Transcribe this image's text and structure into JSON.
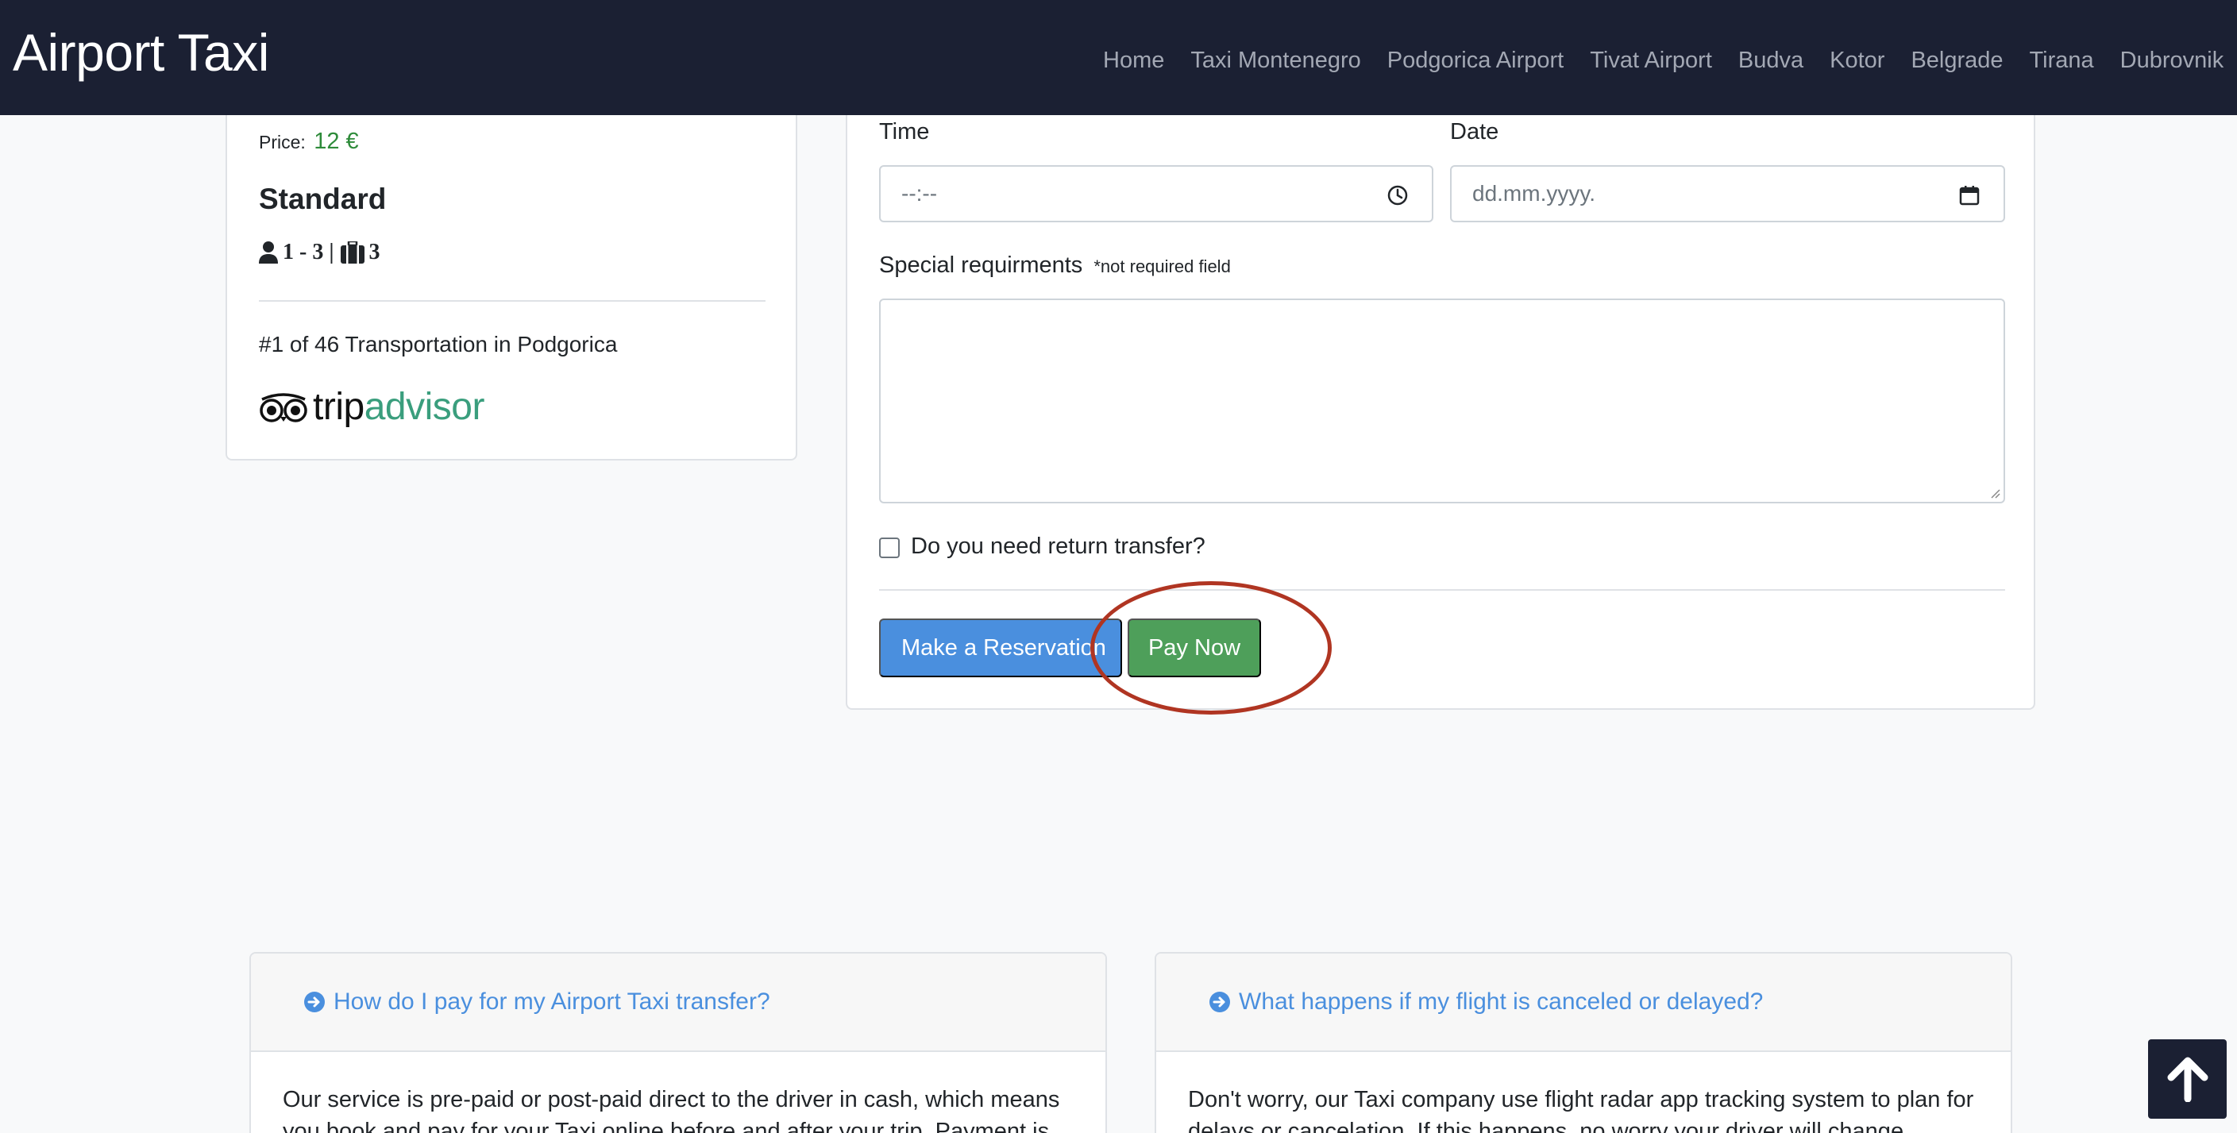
{
  "navbar": {
    "brand": "Airport Taxi",
    "links": [
      "Home",
      "Taxi Montenegro",
      "Podgorica Airport",
      "Tivat Airport",
      "Budva",
      "Kotor",
      "Belgrade",
      "Tirana",
      "Dubrovnik"
    ]
  },
  "vehicle": {
    "price_label": "Price:",
    "price_value": "12 €",
    "name": "Standard",
    "passengers": "1 - 3 |",
    "luggage": "3",
    "ranking": "#1 of 46 Transportation in Podgorica",
    "logo": {
      "part1": "trip",
      "part2": "advisor"
    }
  },
  "form": {
    "time_label": "Time",
    "time_placeholder": "--:--",
    "date_label": "Date",
    "date_placeholder": "dd.mm.yyyy.",
    "special_label": "Special requirments",
    "special_note": "*not required field",
    "return_label": "Do you need return transfer?",
    "reserve_button": "Make a Reservation",
    "pay_button": "Pay Now"
  },
  "faq": [
    {
      "question": "How do I pay for my Airport Taxi transfer?",
      "answer": "Our service is pre-paid or post-paid direct to the driver in cash, which means you book and pay for your Taxi online before and after your trip. Payment is"
    },
    {
      "question": "What happens if my flight is canceled or delayed?",
      "answer": "Don't worry, our Taxi company use flight radar app tracking system to plan for delays or cancelation. If this happens, no worry your driver will change"
    }
  ],
  "colors": {
    "navbar": "#1b2033",
    "primary": "#4a8fde",
    "success": "#4e9f5a",
    "price": "#2e8b3a",
    "annotation": "#b03522"
  }
}
